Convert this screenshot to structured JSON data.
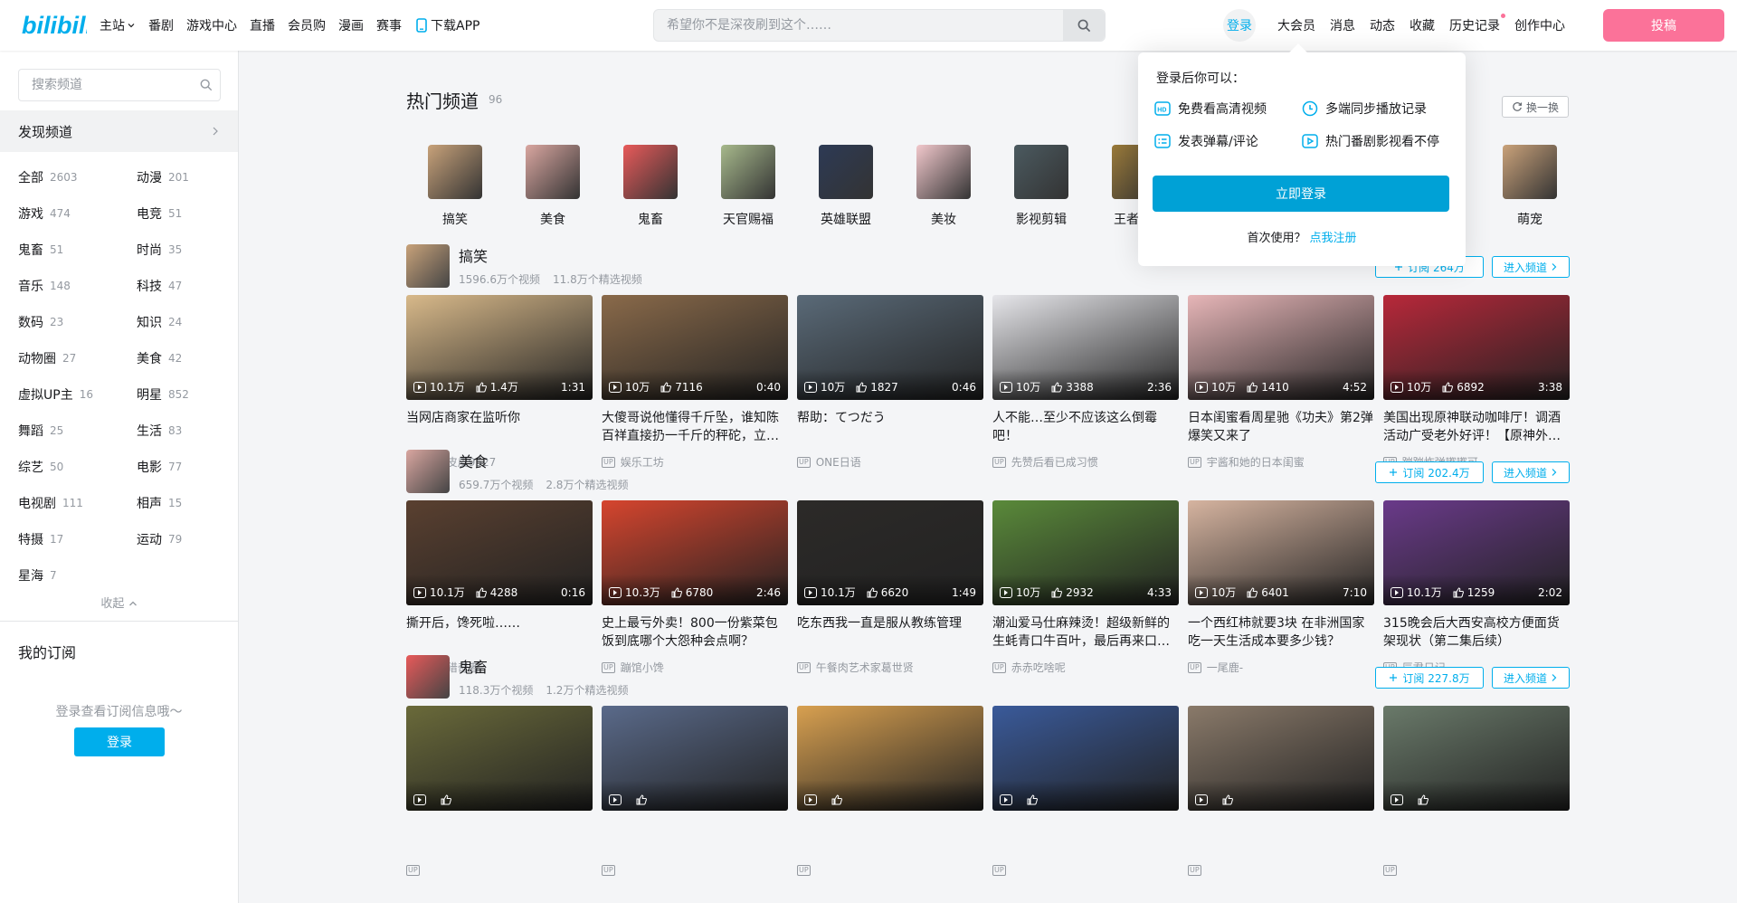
{
  "header": {
    "logo_text": "bilibili",
    "nav": [
      "主站",
      "番剧",
      "游戏中心",
      "直播",
      "会员购",
      "漫画",
      "赛事",
      "下载APP"
    ],
    "search_placeholder": "希望你不是深夜刷到这个……",
    "login": "登录",
    "right_items": [
      "大会员",
      "消息",
      "动态",
      "收藏",
      "历史记录",
      "创作中心"
    ],
    "upload": "投稿"
  },
  "sidebar": {
    "search_placeholder": "搜索频道",
    "discover": "发现频道",
    "categories": [
      {
        "name": "全部",
        "count": "2603"
      },
      {
        "name": "动漫",
        "count": "201"
      },
      {
        "name": "游戏",
        "count": "474"
      },
      {
        "name": "电竞",
        "count": "51"
      },
      {
        "name": "鬼畜",
        "count": "51"
      },
      {
        "name": "时尚",
        "count": "35"
      },
      {
        "name": "音乐",
        "count": "148"
      },
      {
        "name": "科技",
        "count": "47"
      },
      {
        "name": "数码",
        "count": "23"
      },
      {
        "name": "知识",
        "count": "24"
      },
      {
        "name": "动物圈",
        "count": "27"
      },
      {
        "name": "美食",
        "count": "42"
      },
      {
        "name": "虚拟UP主",
        "count": "16"
      },
      {
        "name": "明星",
        "count": "852"
      },
      {
        "name": "舞蹈",
        "count": "25"
      },
      {
        "name": "生活",
        "count": "83"
      },
      {
        "name": "综艺",
        "count": "50"
      },
      {
        "name": "电影",
        "count": "77"
      },
      {
        "name": "电视剧",
        "count": "111"
      },
      {
        "name": "相声",
        "count": "15"
      },
      {
        "name": "特摄",
        "count": "17"
      },
      {
        "name": "运动",
        "count": "79"
      },
      {
        "name": "星海",
        "count": "7"
      }
    ],
    "collapse": "收起",
    "my_subscriptions": "我的订阅",
    "sub_tip": "登录查看订阅信息哦～",
    "login": "登录"
  },
  "hot": {
    "title": "热门频道",
    "count": "96",
    "swap": "换一换",
    "channels": [
      "搞笑",
      "美食",
      "鬼畜",
      "天官赐福",
      "英雄联盟",
      "美妆",
      "影视剪辑",
      "王者荣耀",
      "",
      "",
      "",
      "萌宠"
    ]
  },
  "sections": [
    {
      "name": "搞笑",
      "videos_count": "1596.6万个视频",
      "featured_count": "11.8万个精选视频",
      "subscribe": "订阅 264万",
      "enter": "进入频道",
      "videos": [
        {
          "title": "当网店商家在监听你",
          "views": "10.1万",
          "likes": "1.4万",
          "dur": "1:31",
          "up": "诸葛皮皮9527"
        },
        {
          "title": "大傻哥说他懂得千斤坠，谁知陈百祥直接扔一千斤的秤砣，立…",
          "views": "10万",
          "likes": "7116",
          "dur": "0:40",
          "up": "娱乐工坊"
        },
        {
          "title": "帮助：てつだう",
          "views": "10万",
          "likes": "1827",
          "dur": "0:46",
          "up": "ONE日语"
        },
        {
          "title": "人不能…至少不应该这么倒霉吧！",
          "views": "10万",
          "likes": "3388",
          "dur": "2:36",
          "up": "先赞后看已成习惯"
        },
        {
          "title": "日本闺蜜看周星驰《功夫》第2弹 爆笑又来了",
          "views": "10万",
          "likes": "1410",
          "dur": "4:52",
          "up": "宇酱和她的日本闺蜜"
        },
        {
          "title": "美国出现原神联动咖啡厅！调酒活动广受老外好评！【原神外…",
          "views": "10万",
          "likes": "6892",
          "dur": "3:38",
          "up": "蹦蹦炸弹嘟嘟可"
        }
      ]
    },
    {
      "name": "美食",
      "videos_count": "659.7万个视频",
      "featured_count": "2.8万个精选视频",
      "subscribe": "订阅 202.4万",
      "enter": "进入频道",
      "videos": [
        {
          "title": "撕开后，馋死啦……",
          "views": "10.1万",
          "likes": "4288",
          "dur": "0:16",
          "up": "美好猎奇者"
        },
        {
          "title": "史上最亏外卖！800一份紫菜包饭到底哪个大怨种会点啊？",
          "views": "10.3万",
          "likes": "6780",
          "dur": "2:46",
          "up": "蹦馆小馋"
        },
        {
          "title": "吃东西我一直是服从教练管理",
          "views": "10.1万",
          "likes": "6620",
          "dur": "1:49",
          "up": "午餐肉艺术家葛世贤"
        },
        {
          "title": "潮汕爱马仕麻辣烫！超级新鲜的生蚝青口牛百叶，最后再来口…",
          "views": "10万",
          "likes": "2932",
          "dur": "4:33",
          "up": "赤赤吃啥呢"
        },
        {
          "title": "一个西红柿就要3块 在非洲国家吃一天生活成本要多少钱？",
          "views": "10万",
          "likes": "6401",
          "dur": "7:10",
          "up": "一尾鹿-"
        },
        {
          "title": "315晚会后大西安高校方便面货架现状（第二集后续）",
          "views": "10.1万",
          "likes": "1259",
          "dur": "2:02",
          "up": "辰君日记"
        }
      ]
    },
    {
      "name": "鬼畜",
      "videos_count": "118.3万个视频",
      "featured_count": "1.2万个精选视频",
      "subscribe": "订阅 227.8万",
      "enter": "进入频道",
      "videos": [
        {
          "title": "",
          "views": "",
          "likes": "",
          "dur": "",
          "up": ""
        },
        {
          "title": "",
          "views": "",
          "likes": "",
          "dur": "",
          "up": ""
        },
        {
          "title": "",
          "views": "",
          "likes": "",
          "dur": "",
          "up": ""
        },
        {
          "title": "",
          "views": "",
          "likes": "",
          "dur": "",
          "up": ""
        },
        {
          "title": "",
          "views": "",
          "likes": "",
          "dur": "",
          "up": ""
        },
        {
          "title": "",
          "views": "",
          "likes": "",
          "dur": "",
          "up": ""
        }
      ]
    }
  ],
  "popover": {
    "title": "登录后你可以：",
    "features": [
      "免费看高清视频",
      "多端同步播放记录",
      "发表弹幕/评论",
      "热门番剧影视看不停"
    ],
    "login": "立即登录",
    "first_time": "首次使用？",
    "register": "点我注册"
  },
  "colors": {
    "accent": "#00aeec",
    "pink": "#fb7299",
    "login_button": "#00a1d6"
  }
}
